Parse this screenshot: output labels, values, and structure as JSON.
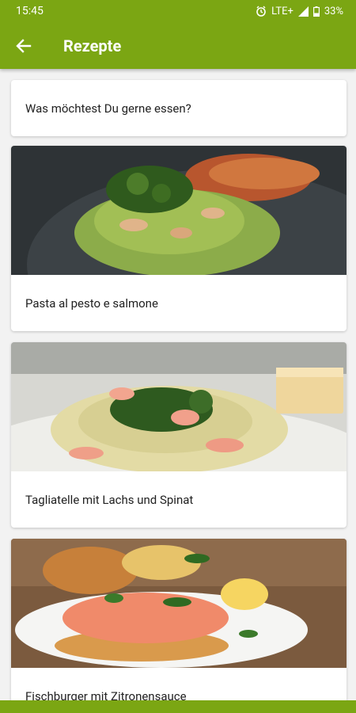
{
  "status": {
    "time": "15:45",
    "network": "LTE+",
    "battery": "33%"
  },
  "header": {
    "title": "Rezepte"
  },
  "search": {
    "text": "Was möchtest Du gerne essen?"
  },
  "recipes": [
    {
      "title": "Pasta al pesto e salmone"
    },
    {
      "title": "Tagliatelle mit Lachs und Spinat"
    },
    {
      "title": "Fischburger mit Zitronensauce"
    }
  ],
  "colors": {
    "accent": "#7ba613",
    "background": "#f2f2f2"
  }
}
